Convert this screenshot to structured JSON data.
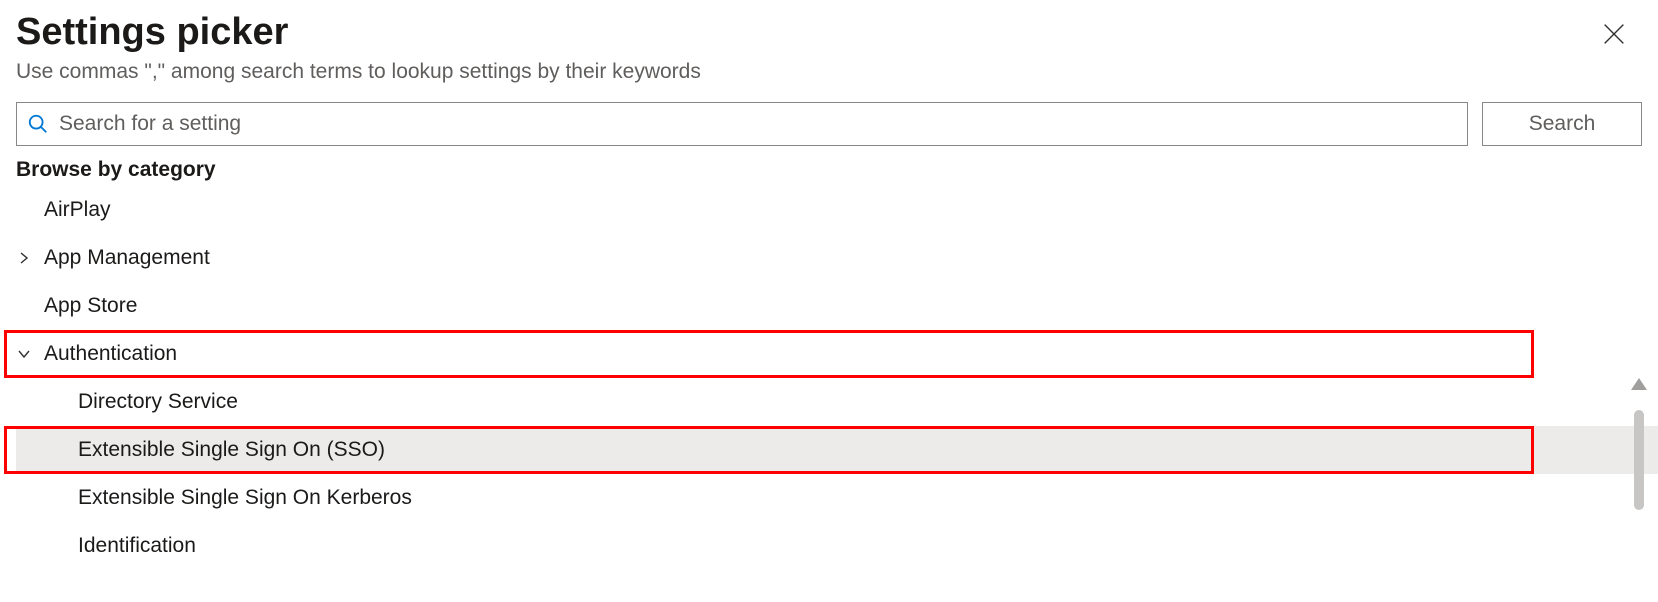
{
  "header": {
    "title": "Settings picker",
    "subtitle": "Use commas \",\" among search terms to lookup settings by their keywords"
  },
  "search": {
    "placeholder": "Search for a setting",
    "value": "",
    "button_label": "Search"
  },
  "browse_label": "Browse by category",
  "categories": [
    {
      "label": "AirPlay",
      "has_children": false,
      "expanded": false
    },
    {
      "label": "App Management",
      "has_children": true,
      "expanded": false
    },
    {
      "label": "App Store",
      "has_children": false,
      "expanded": false
    },
    {
      "label": "Authentication",
      "has_children": true,
      "expanded": true,
      "highlighted": true,
      "children": [
        {
          "label": "Directory Service",
          "selected": false
        },
        {
          "label": "Extensible Single Sign On (SSO)",
          "selected": true,
          "highlighted": true
        },
        {
          "label": "Extensible Single Sign On Kerberos",
          "selected": false
        },
        {
          "label": "Identification",
          "selected": false
        }
      ]
    }
  ]
}
